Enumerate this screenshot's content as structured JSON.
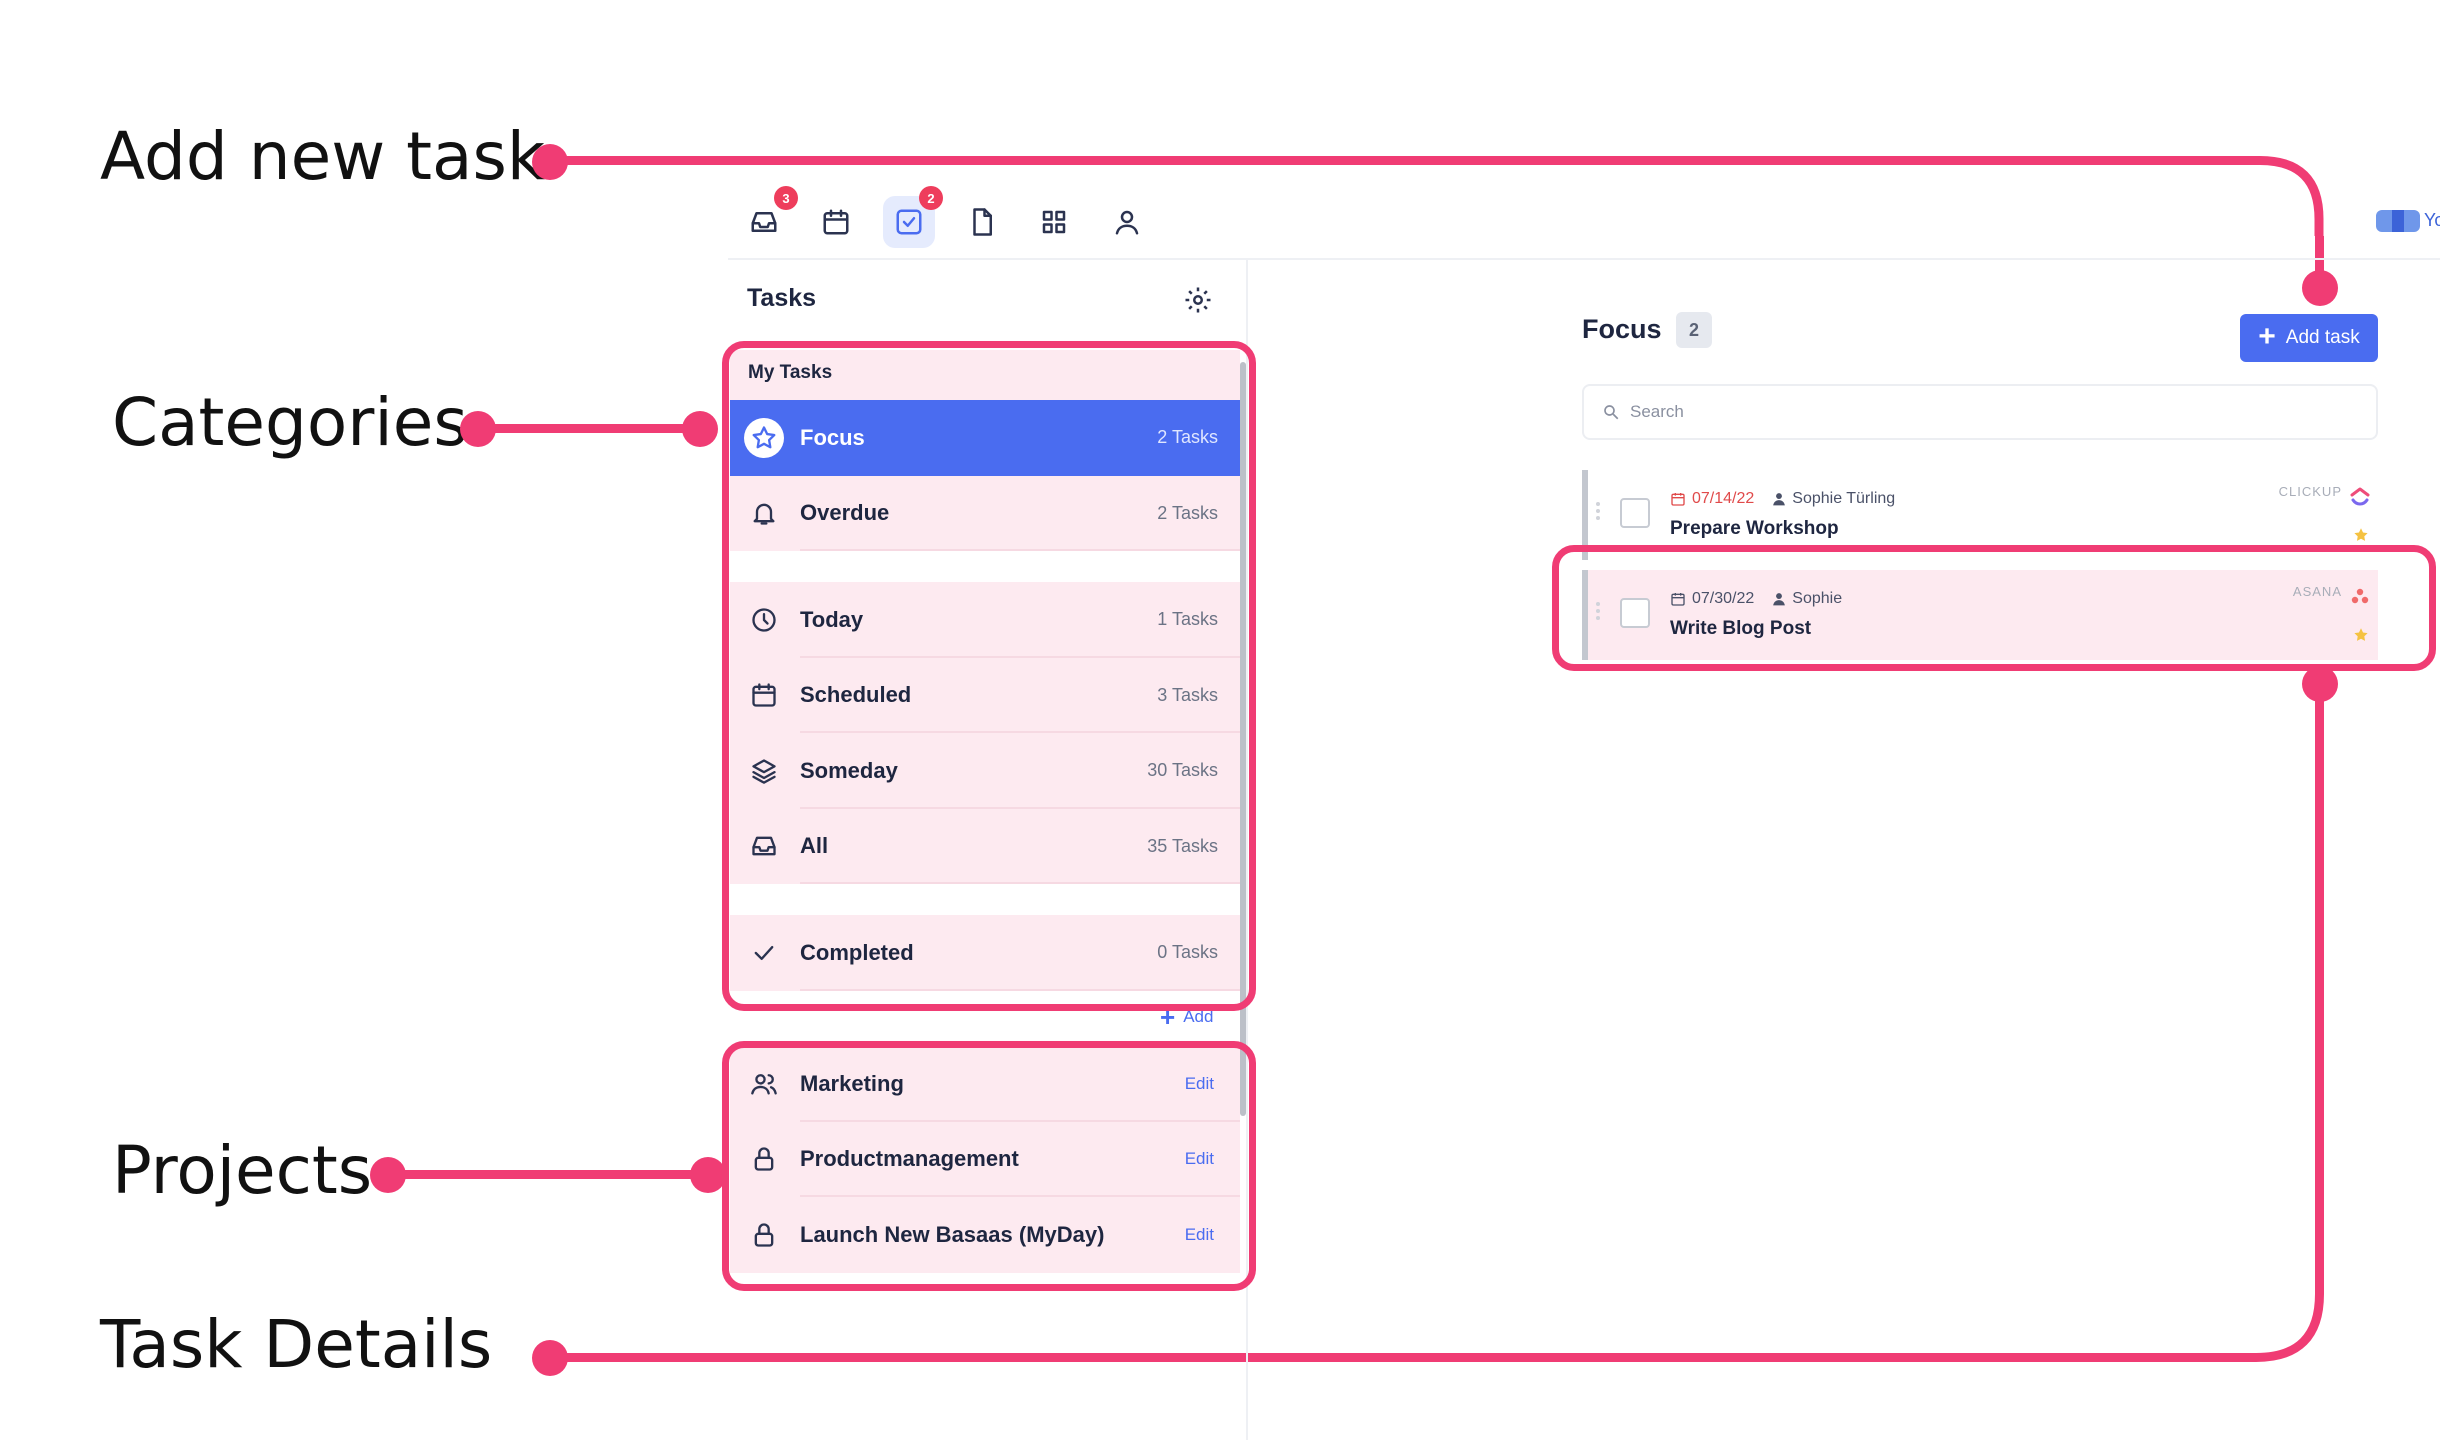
{
  "annotations": {
    "add_new_task": "Add new task",
    "categories": "Categories",
    "projects": "Projects",
    "task_details": "Task Details"
  },
  "topbar": {
    "icons": [
      {
        "name": "inbox-icon",
        "badge": "3"
      },
      {
        "name": "calendar-icon",
        "badge": ""
      },
      {
        "name": "tasks-icon",
        "badge": "2",
        "active": true
      },
      {
        "name": "document-icon",
        "badge": ""
      },
      {
        "name": "apps-grid-icon",
        "badge": ""
      },
      {
        "name": "user-icon",
        "badge": ""
      }
    ],
    "brand_text": "Yo"
  },
  "sidebar": {
    "title": "Tasks",
    "section_label": "My Tasks",
    "categories": [
      {
        "label": "Focus",
        "count": "2 Tasks",
        "icon": "star-icon"
      },
      {
        "label": "Overdue",
        "count": "2 Tasks",
        "icon": "bell-icon"
      },
      {
        "label": "Today",
        "count": "1 Tasks",
        "icon": "clock-icon"
      },
      {
        "label": "Scheduled",
        "count": "3 Tasks",
        "icon": "calendar-icon"
      },
      {
        "label": "Someday",
        "count": "30 Tasks",
        "icon": "layers-icon"
      },
      {
        "label": "All",
        "count": "35 Tasks",
        "icon": "inbox-icon"
      },
      {
        "label": "Completed",
        "count": "0 Tasks",
        "icon": "check-icon"
      }
    ],
    "add_label": "Add",
    "projects": [
      {
        "label": "Marketing",
        "edit": "Edit",
        "icon": "users-icon"
      },
      {
        "label": "Productmanagement",
        "edit": "Edit",
        "icon": "lock-icon"
      },
      {
        "label": "Launch New Basaas (MyDay)",
        "edit": "Edit",
        "icon": "lock-icon"
      }
    ]
  },
  "main": {
    "title": "Focus",
    "count": "2",
    "add_task_label": "Add task",
    "search_placeholder": "Search",
    "tasks": [
      {
        "date": "07/14/22",
        "assignee": "Sophie Türling",
        "title": "Prepare Workshop",
        "source": "CLICKUP",
        "date_status": "overdue"
      },
      {
        "date": "07/30/22",
        "assignee": "Sophie",
        "title": "Write Blog Post",
        "source": "ASANA",
        "date_status": "normal"
      }
    ]
  },
  "colors": {
    "accent": "#4a6cf0",
    "highlight": "#f03c74",
    "highlight_fill": "#fdeaf0",
    "overdue": "#e04a4a",
    "badge": "#ee3d5c"
  }
}
